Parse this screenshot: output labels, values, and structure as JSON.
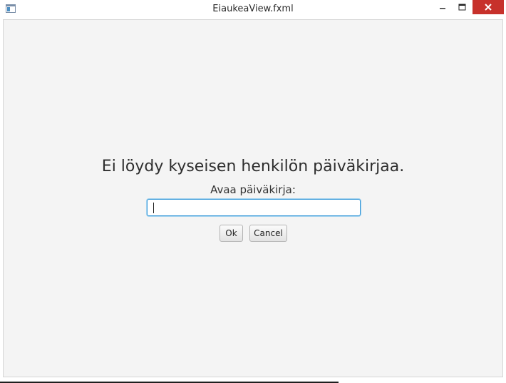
{
  "window": {
    "title": "EiaukeaView.fxml",
    "icon": "app-window-icon",
    "controls": {
      "minimize": "minimize-icon",
      "maximize": "maximize-icon",
      "close": "close-icon",
      "close_color": "#c7312b"
    }
  },
  "content": {
    "heading": "Ei löydy kyseisen henkilön päiväkirjaa.",
    "prompt_label": "Avaa päiväkirja:",
    "input": {
      "value": "",
      "placeholder": "",
      "focus_color": "#3a9ad9"
    },
    "buttons": {
      "ok": "Ok",
      "cancel": "Cancel"
    }
  }
}
